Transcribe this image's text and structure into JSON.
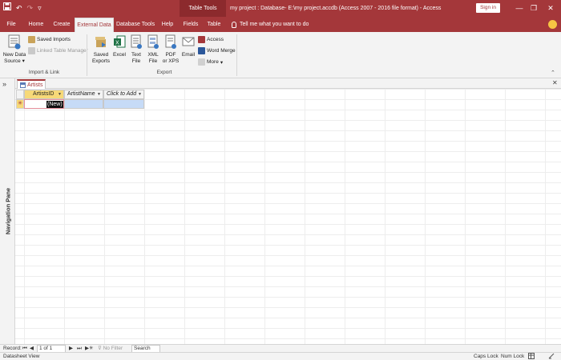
{
  "titlebar": {
    "context_tools": "Table Tools",
    "title": "my project : Database- E:\\my project.accdb (Access 2007 - 2016 file format)  -  Access",
    "signin": "Sign in",
    "save_icon": "save-icon",
    "undo_icon": "undo-icon",
    "redo_icon": "redo-icon",
    "customize_icon": "customize-qat-icon",
    "minimize": "—",
    "restore": "❐",
    "close": "✕"
  },
  "ribbon_tabs": [
    {
      "label": "File"
    },
    {
      "label": "Home"
    },
    {
      "label": "Create"
    },
    {
      "label": "External Data"
    },
    {
      "label": "Database Tools"
    },
    {
      "label": "Help"
    },
    {
      "label": "Fields"
    },
    {
      "label": "Table"
    }
  ],
  "active_tab": "External Data",
  "tell_me": "Tell me what you want to do",
  "ribbon": {
    "import_group": {
      "label": "Import & Link",
      "new_data_source_line1": "New Data",
      "new_data_source_line2": "Source",
      "saved_imports": "Saved Imports",
      "linked_table_manager": "Linked Table Manager"
    },
    "export_group": {
      "label": "Export",
      "saved_exports_line1": "Saved",
      "saved_exports_line2": "Exports",
      "excel": "Excel",
      "text_line1": "Text",
      "text_line2": "File",
      "xml_line1": "XML",
      "xml_line2": "File",
      "pdf_line1": "PDF",
      "pdf_line2": "or XPS",
      "email": "Email",
      "access": "Access",
      "word_merge": "Word Merge",
      "more": "More"
    },
    "accent_color": "#a4373a"
  },
  "nav_pane": {
    "label": "Navigation Pane",
    "toggle": "»"
  },
  "document": {
    "tab_label": "Artists",
    "close": "✕",
    "columns": [
      {
        "label": "ArtistsID"
      },
      {
        "label": "ArtistName"
      },
      {
        "label": "Click to Add"
      }
    ],
    "new_row_marker": "✳",
    "new_value": "(New)",
    "selected_header_color": "#f7d978",
    "selected_row_color": "#c6dbf7"
  },
  "record_nav": {
    "label": "Record:",
    "first": "⏮",
    "prev": "◀",
    "position": "1 of 1",
    "next": "▶",
    "last": "⏭",
    "new": "▶✳",
    "filter": "No Filter",
    "search": "Search"
  },
  "status": {
    "view": "Datasheet View",
    "caps_lock": "Caps Lock",
    "num_lock": "Num Lock"
  }
}
